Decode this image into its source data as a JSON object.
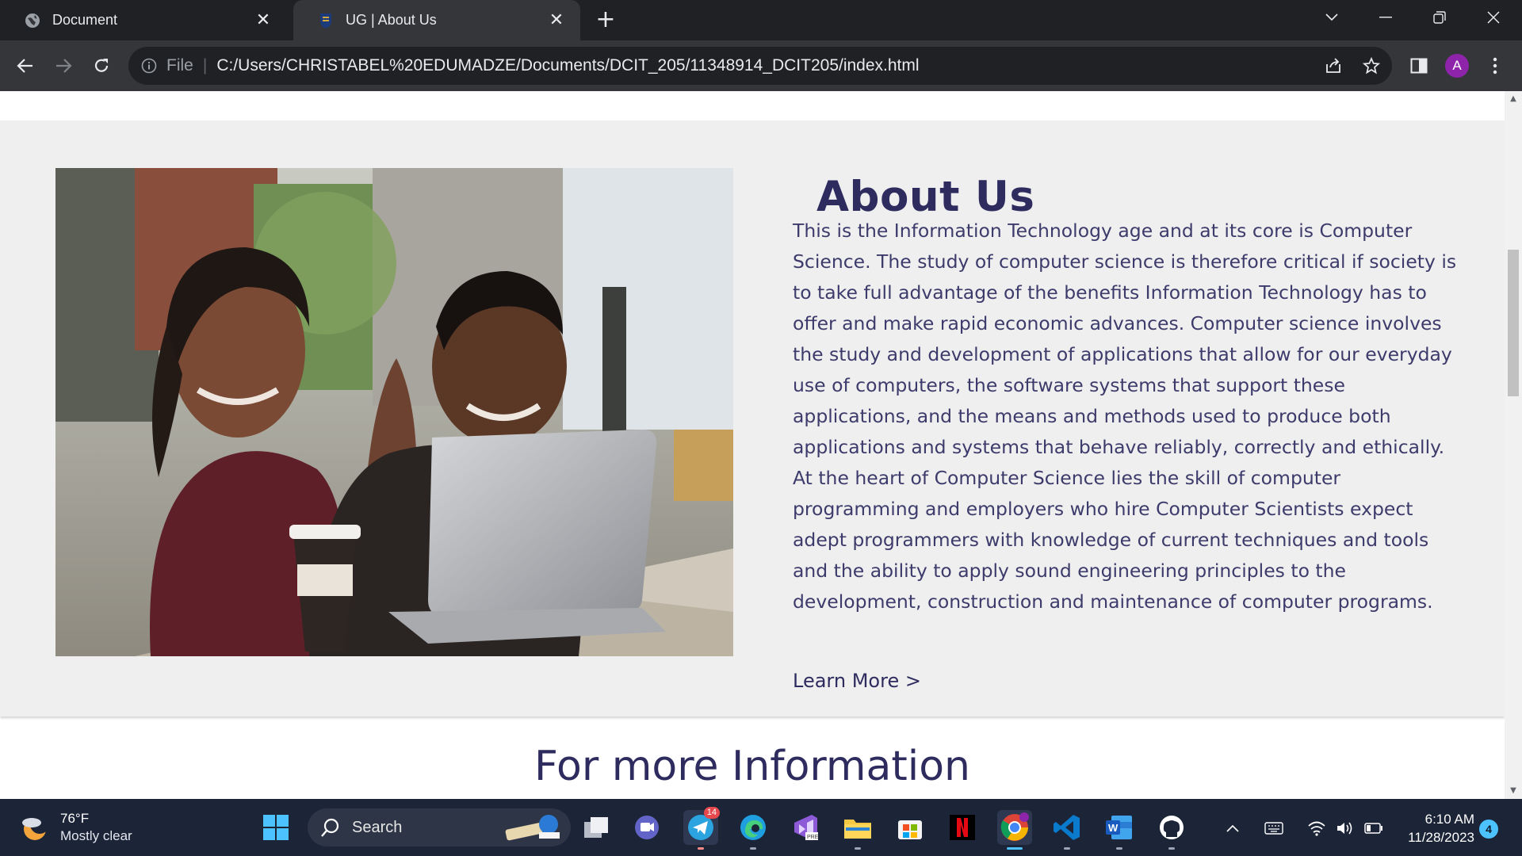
{
  "browser": {
    "tabs": [
      {
        "title": "Document",
        "active": false,
        "favicon": "globe-icon"
      },
      {
        "title": "UG | About Us",
        "active": true,
        "favicon": "ug-crest-icon"
      }
    ],
    "address": {
      "info_label": "File",
      "url": "C:/Users/CHRISTABEL%20EDUMADZE/Documents/DCIT_205/11348914_DCIT205/index.html"
    },
    "profile_initial": "A"
  },
  "page": {
    "about": {
      "title": "About Us",
      "body": "This is the Information Technology age and at its core is Computer Science. The study of computer science is therefore critical if society is to take full advantage of the benefits Information Technology has to offer and make rapid economic advances. Computer science involves the study and development of applications that allow for our everyday use of computers, the software systems that support these applications, and the means and methods used to produce both applications and systems that behave reliably, correctly and ethically. At the heart of Computer Science lies the skill of computer programming and employers who hire Computer Scientists expect adept programmers with knowledge of current techniques and tools and the ability to apply sound engineering principles to the development, construction and maintenance of computer programs.",
      "link": "Learn More >"
    },
    "next_section_title": "For more Information",
    "colors": {
      "heading": "#2e2b5f",
      "section_bg": "#efefef"
    }
  },
  "taskbar": {
    "weather": {
      "temp": "76°F",
      "desc": "Mostly clear"
    },
    "search_label": "Search",
    "telegram_badge": "14",
    "clock": {
      "time": "6:10 AM",
      "date": "11/28/2023"
    },
    "notifications": "4"
  }
}
